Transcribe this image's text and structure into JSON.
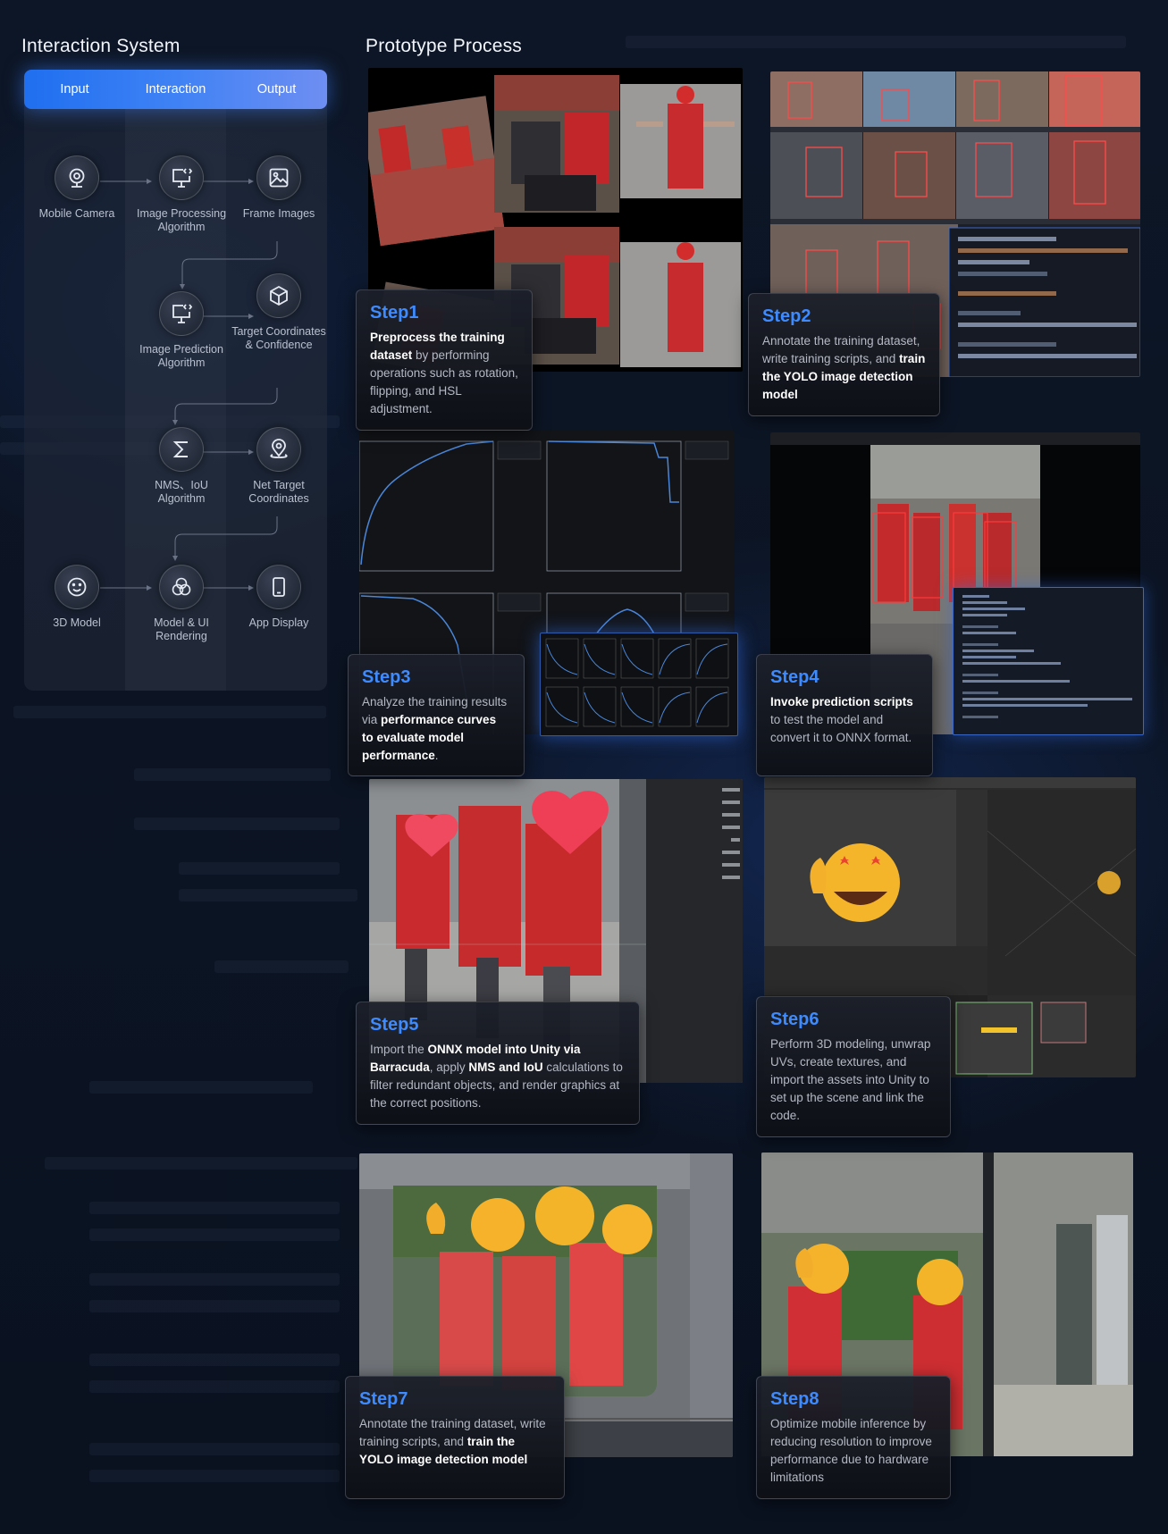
{
  "left": {
    "title": "Interaction System",
    "tabs": [
      "Input",
      "Interaction",
      "Output"
    ],
    "nodes": {
      "mobile_camera": "Mobile Camera",
      "image_processing": "Image Processing Algorithm",
      "frame_images": "Frame Images",
      "image_prediction": "Image Prediction Algorithm",
      "target_coords": "Target Coordinates & Confidence",
      "nms_iou": "NMS、IoU Algorithm",
      "net_target": "Net Target Coordinates",
      "model_3d": "3D Model",
      "model_ui": "Model & UI Rendering",
      "app_display": "App Display"
    }
  },
  "right": {
    "title": "Prototype Process",
    "steps": [
      {
        "title": "Step1",
        "parts": [
          [
            "Preprocess the training dataset",
            true
          ],
          [
            " by performing operations such as rotation, flipping, and HSL adjustment.",
            false
          ]
        ]
      },
      {
        "title": "Step2",
        "parts": [
          [
            "Annotate the training dataset, write training scripts, and ",
            false
          ],
          [
            "train the YOLO image detection model",
            true
          ]
        ]
      },
      {
        "title": "Step3",
        "parts": [
          [
            "Analyze the training results via ",
            false
          ],
          [
            "performance curves to evaluate model performance",
            true
          ],
          [
            ".",
            false
          ]
        ]
      },
      {
        "title": "Step4",
        "parts": [
          [
            "Invoke prediction scripts",
            true
          ],
          [
            " to test the model and convert it to ONNX format.",
            false
          ]
        ]
      },
      {
        "title": "Step5",
        "parts": [
          [
            "Import the ",
            false
          ],
          [
            "ONNX model into Unity via Barracuda",
            true
          ],
          [
            ", apply ",
            false
          ],
          [
            "NMS and IoU",
            true
          ],
          [
            " calculations to filter redundant objects, and render graphics at the correct positions.",
            false
          ]
        ]
      },
      {
        "title": "Step6",
        "parts": [
          [
            "Perform 3D modeling, unwrap UVs, create textures, and import the assets into Unity to set up the scene and link the code.",
            false
          ]
        ]
      },
      {
        "title": "Step7",
        "parts": [
          [
            "Annotate the training dataset, write training scripts, and ",
            false
          ],
          [
            "train the YOLO image detection model",
            true
          ]
        ]
      },
      {
        "title": "Step8",
        "parts": [
          [
            "Optimize mobile inference by reducing resolution to improve performance due to hardware limitations",
            false
          ]
        ]
      }
    ]
  },
  "colors": {
    "accent": "#3d8bff",
    "tab_start": "#1f6ff0",
    "tab_end": "#6e8ef2",
    "background": "#0c1424"
  }
}
